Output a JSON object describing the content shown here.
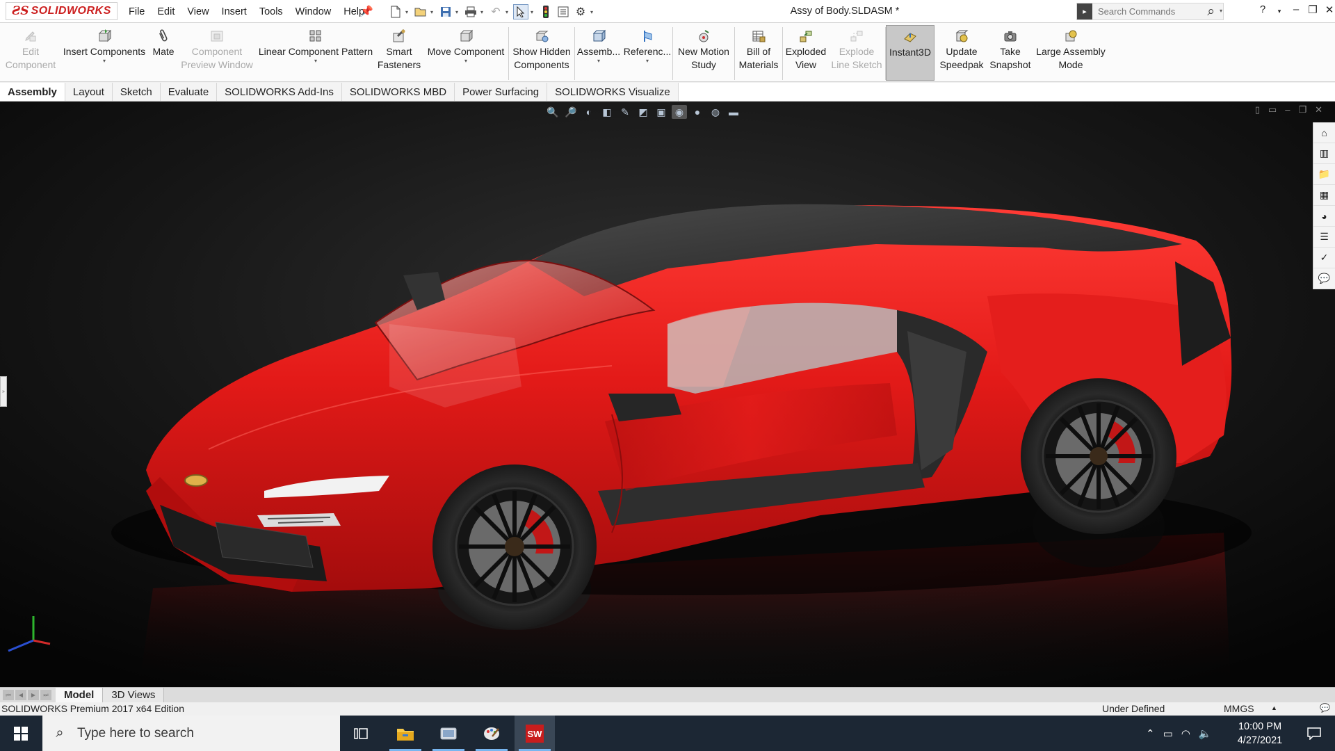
{
  "app": {
    "logo_ds": "ƧS",
    "logo_name": "SOLIDWORKS",
    "document_title": "Assy of Body.SLDASM *"
  },
  "menu": [
    "File",
    "Edit",
    "View",
    "Insert",
    "Tools",
    "Window",
    "Help"
  ],
  "search": {
    "placeholder": "Search Commands"
  },
  "commands": {
    "edit_component": [
      "Edit",
      "Component"
    ],
    "insert_components": "Insert Components",
    "mate": "Mate",
    "component_preview": [
      "Component",
      "Preview Window"
    ],
    "linear_pattern": "Linear Component Pattern",
    "smart_fasteners": [
      "Smart",
      "Fasteners"
    ],
    "move_component": "Move Component",
    "show_hidden": [
      "Show Hidden",
      "Components"
    ],
    "assembly_features": "Assemb...",
    "reference_geometry": "Referenc...",
    "new_motion_study": [
      "New Motion",
      "Study"
    ],
    "bill_of_materials": [
      "Bill of",
      "Materials"
    ],
    "exploded_view": [
      "Exploded",
      "View"
    ],
    "explode_line_sketch": [
      "Explode",
      "Line Sketch"
    ],
    "instant3d": "Instant3D",
    "update_speedpak": [
      "Update",
      "Speedpak"
    ],
    "take_snapshot": [
      "Take",
      "Snapshot"
    ],
    "large_assembly_mode": [
      "Large Assembly",
      "Mode"
    ]
  },
  "tabs": [
    "Assembly",
    "Layout",
    "Sketch",
    "Evaluate",
    "SOLIDWORKS Add-Ins",
    "SOLIDWORKS MBD",
    "Power Surfacing",
    "SOLIDWORKS Visualize"
  ],
  "active_tab": "Assembly",
  "bottom_tabs": [
    "Model",
    "3D Views"
  ],
  "status": {
    "edition": "SOLIDWORKS Premium 2017 x64 Edition",
    "definition": "Under Defined",
    "units": "MMGS"
  },
  "taskbar": {
    "search_placeholder": "Type here to search",
    "time": "10:00 PM",
    "date": "4/27/2021"
  },
  "colors": {
    "car_body": "#e01b1b",
    "viewport_bg": "#0c0c0c",
    "taskbar_bg": "#1c2734",
    "accent": "#cc1f1f"
  }
}
